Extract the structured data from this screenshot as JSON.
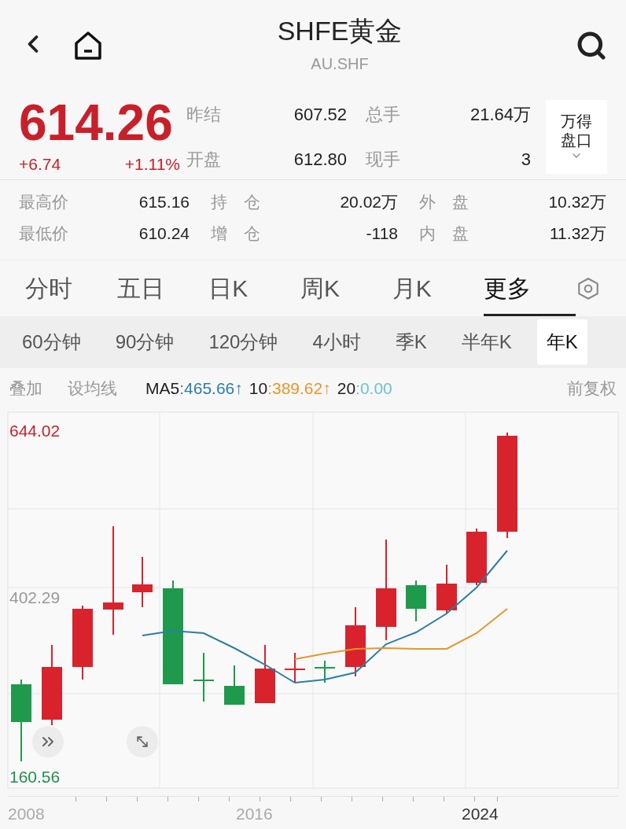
{
  "header": {
    "title": "SHFE黄金",
    "subtitle": "AU.SHF"
  },
  "quote": {
    "price": "614.26",
    "change": "+6.74",
    "change_pct": "+1.11%",
    "fields": [
      {
        "label": "昨结",
        "value": "607.52"
      },
      {
        "label": "总手",
        "value": "21.64万"
      },
      {
        "label": "开盘",
        "value": "612.80"
      },
      {
        "label": "现手",
        "value": "3"
      }
    ],
    "panel_button": "万得盘口"
  },
  "stats": [
    {
      "label": "最高价",
      "value": "615.16"
    },
    {
      "label": "持仓",
      "value": "20.02万"
    },
    {
      "label": "外盘",
      "value": "10.32万"
    },
    {
      "label": "最低价",
      "value": "610.24"
    },
    {
      "label": "增仓",
      "value": "-118"
    },
    {
      "label": "内盘",
      "value": "11.32万"
    }
  ],
  "tabs": [
    {
      "label": "分时",
      "selected": false
    },
    {
      "label": "五日",
      "selected": false
    },
    {
      "label": "日K",
      "selected": false
    },
    {
      "label": "周K",
      "selected": false
    },
    {
      "label": "月K",
      "selected": false
    },
    {
      "label": "更多",
      "selected": true
    }
  ],
  "subtabs": [
    {
      "label": "60分钟",
      "selected": false
    },
    {
      "label": "90分钟",
      "selected": false
    },
    {
      "label": "120分钟",
      "selected": false
    },
    {
      "label": "4小时",
      "selected": false
    },
    {
      "label": "季K",
      "selected": false
    },
    {
      "label": "半年K",
      "selected": false
    },
    {
      "label": "年K",
      "selected": true
    }
  ],
  "indicator_bar": {
    "overlay": "叠加",
    "ma_settings": "设均线",
    "adjust": "前复权",
    "ma": [
      {
        "label": "MA5",
        "value": ":465.66↑",
        "color": "#2a7fa8"
      },
      {
        "label": "10",
        "value": ":389.62↑",
        "color": "#e8962a"
      },
      {
        "label": "20",
        "value": ":0.00",
        "color": "#6cc4cf"
      }
    ]
  },
  "chart": {
    "y_labels": [
      {
        "text": "644.02",
        "color": "#c8202a"
      },
      {
        "text": "402.29",
        "color": "#999999"
      },
      {
        "text": "160.56",
        "color": "#1f8f4a"
      }
    ],
    "x_labels": [
      {
        "text": "2008",
        "selected": false
      },
      {
        "text": "2016",
        "selected": false
      },
      {
        "text": "2024",
        "selected": true
      }
    ]
  }
}
